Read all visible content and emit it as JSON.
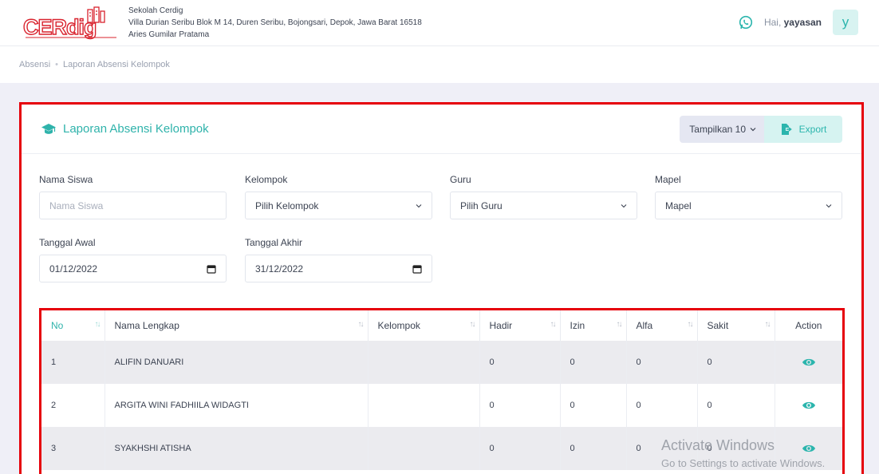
{
  "header": {
    "school_name": "Sekolah Cerdig",
    "address": "Villa Durian Seribu Blok M 14, Duren Seribu, Bojongsari, Depok, Jawa Barat 16518",
    "principal": "Aries Gumilar Pratama",
    "greeting": "Hai,",
    "username": "yayasan",
    "avatar_letter": "y"
  },
  "logo": {
    "text": "CERdig"
  },
  "breadcrumb": {
    "items": [
      "Absensi",
      "Laporan Absensi Kelompok"
    ]
  },
  "card": {
    "title": "Laporan Absensi Kelompok",
    "tampilkan_label": "Tampilkan 10",
    "export_label": "Export"
  },
  "filters": {
    "nama_siswa": {
      "label": "Nama Siswa",
      "placeholder": "Nama Siswa"
    },
    "kelompok": {
      "label": "Kelompok",
      "value": "Pilih Kelompok"
    },
    "guru": {
      "label": "Guru",
      "value": "Pilih Guru"
    },
    "mapel": {
      "label": "Mapel",
      "value": "Mapel"
    },
    "tanggal_awal": {
      "label": "Tanggal Awal",
      "value": "01/12/2022"
    },
    "tanggal_akhir": {
      "label": "Tanggal Akhir",
      "value": "31/12/2022"
    }
  },
  "table": {
    "columns": [
      "No",
      "Nama Lengkap",
      "Kelompok",
      "Hadir",
      "Izin",
      "Alfa",
      "Sakit",
      "Action"
    ],
    "rows": [
      {
        "no": "1",
        "nama": "ALIFIN DANUARI",
        "kelompok": "",
        "hadir": "0",
        "izin": "0",
        "alfa": "0",
        "sakit": "0"
      },
      {
        "no": "2",
        "nama": "ARGITA WINI FADHIILA WIDAGTI",
        "kelompok": "",
        "hadir": "0",
        "izin": "0",
        "alfa": "0",
        "sakit": "0"
      },
      {
        "no": "3",
        "nama": "SYAKHSHI ATISHA",
        "kelompok": "",
        "hadir": "0",
        "izin": "0",
        "alfa": "0",
        "sakit": "0"
      }
    ]
  },
  "watermark": {
    "line1": "Activate Windows",
    "line2": "Go to Settings to activate Windows."
  },
  "colors": {
    "accent": "#2fb3ab",
    "highlight_border": "#e6000b",
    "logo_red": "#d9232e"
  }
}
